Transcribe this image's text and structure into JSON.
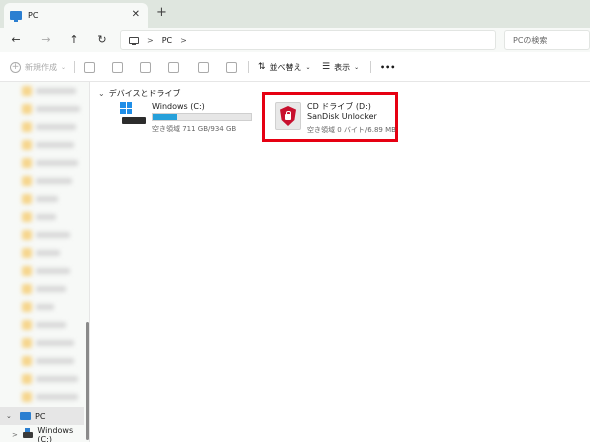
{
  "window": {
    "tab_title": "PC",
    "tab_close": "✕",
    "new_tab": "+"
  },
  "nav": {
    "back": "←",
    "forward": "→",
    "up": "↑",
    "refresh": "↻",
    "breadcrumb": [
      "PC"
    ],
    "search_placeholder": "PCの検索"
  },
  "toolbar": {
    "new_label": "新規作成",
    "sort_label": "並べ替え",
    "view_label": "表示",
    "more": "•••"
  },
  "sidebar": {
    "pc_label": "PC",
    "windows_label": "Windows (C:)"
  },
  "main": {
    "group_title": "デバイスとドライブ",
    "drives": [
      {
        "name": "Windows (C:)",
        "free_text": "空き領域 711 GB/934 GB",
        "used_fraction": 0.24
      },
      {
        "name": "CD ドライブ (D:) SanDisk Unlocker",
        "free_text": "空き領域 0 バイト/6.89 MB"
      }
    ]
  },
  "colors": {
    "highlight": "#e60012",
    "accent": "#26a0da"
  }
}
